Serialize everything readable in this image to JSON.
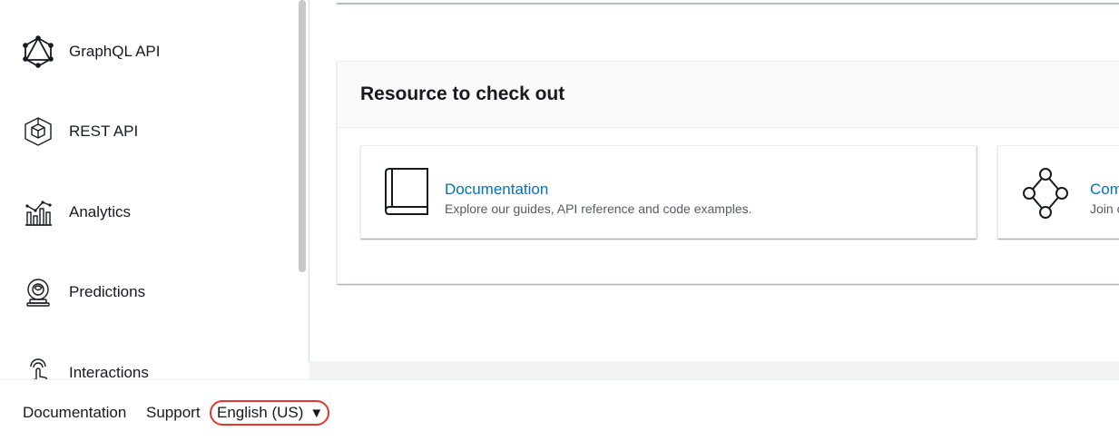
{
  "sidebar": {
    "items": [
      {
        "label": "GraphQL API",
        "icon": "graphql-icon"
      },
      {
        "label": "REST API",
        "icon": "cube-icon"
      },
      {
        "label": "Analytics",
        "icon": "analytics-chart-icon"
      },
      {
        "label": "Predictions",
        "icon": "crystal-ball-icon"
      },
      {
        "label": "Interactions",
        "icon": "touch-hand-icon"
      }
    ]
  },
  "main": {
    "resource_section": {
      "title": "Resource to check out",
      "cards": [
        {
          "title": "Documentation",
          "description": "Explore our guides, API reference and code examples.",
          "icon": "book-icon"
        },
        {
          "title": "Com",
          "description": "Join c",
          "icon": "community-nodes-icon"
        }
      ]
    }
  },
  "footer": {
    "documentation_label": "Documentation",
    "support_label": "Support",
    "language": {
      "selected": "English (US)",
      "caret": "▼",
      "highlight_color": "#e03a2d"
    }
  },
  "colors": {
    "link": "#0073bb",
    "text": "#16191f",
    "muted": "#545b64"
  }
}
